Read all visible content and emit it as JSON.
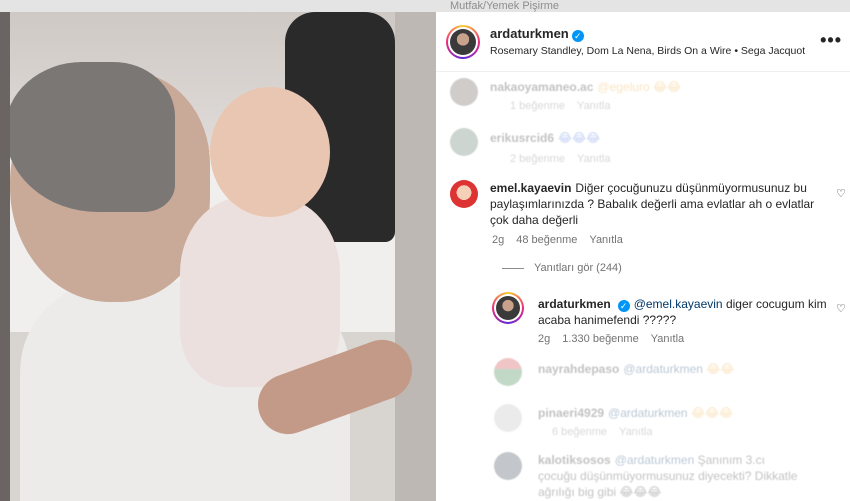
{
  "top": {
    "breadcrumb": "Mutfak/Yemek Pişirme"
  },
  "post": {
    "username": "ardaturkmen",
    "audio": "Rosemary Standley, Dom La Nena, Birds On a Wire • Sega Jacquot",
    "more_label": "•••"
  },
  "comments": [
    {
      "user": "nakaoyamaneo.ac",
      "text": "@egeluro 😂😂",
      "meta_likes": "1 beğenme",
      "reply": "Yanıtla",
      "faded": true
    },
    {
      "user": "erikusrcid6",
      "text": "😂😂😂",
      "meta_likes": "2 beğenme",
      "reply": "Yanıtla",
      "faded": true
    },
    {
      "user": "emel.kayaevin",
      "text": "Diğer çocuğunuzu düşünmüyormusunuz bu paylaşımlarınızda ? Babalık değerli ama evlatlar ah o evlatlar çok daha değerli",
      "time": "2g",
      "likes": "48 beğenme",
      "reply": "Yanıtla"
    }
  ],
  "view_replies": "Yanıtları gör (244)",
  "reply": {
    "user": "ardaturkmen",
    "mention": "@emel.kayaevin",
    "text": "diger cocugum kim acaba hanimefendi ?????",
    "time": "2g",
    "likes": "1.330 beğenme",
    "reply_label": "Yanıtla"
  },
  "faded_replies": [
    {
      "user": "nayrahdepaso",
      "mention": "@ardaturkmen",
      "text": "😂😂",
      "likes": "",
      "reply": ""
    },
    {
      "user": "pinaeri4929",
      "mention": "@ardaturkmen",
      "text": "😂😂😂",
      "likes": "6 beğenme",
      "reply": "Yanıtla"
    },
    {
      "user": "kalotiksosos",
      "mention": "@ardaturkmen",
      "text": "Şanınım 3.cı çocuğu düşünmüyormusunuz diyecekti? Dikkatle ağrılığı big gibi 😂😂😂",
      "likes": "",
      "reply": ""
    }
  ],
  "colors": {
    "verified": "#0095f6",
    "mention": "#00376b",
    "meta": "#737373"
  },
  "icons": {
    "verified": "verified-badge-icon",
    "heart": "heart-outline-icon",
    "more": "more-horizontal-icon"
  }
}
